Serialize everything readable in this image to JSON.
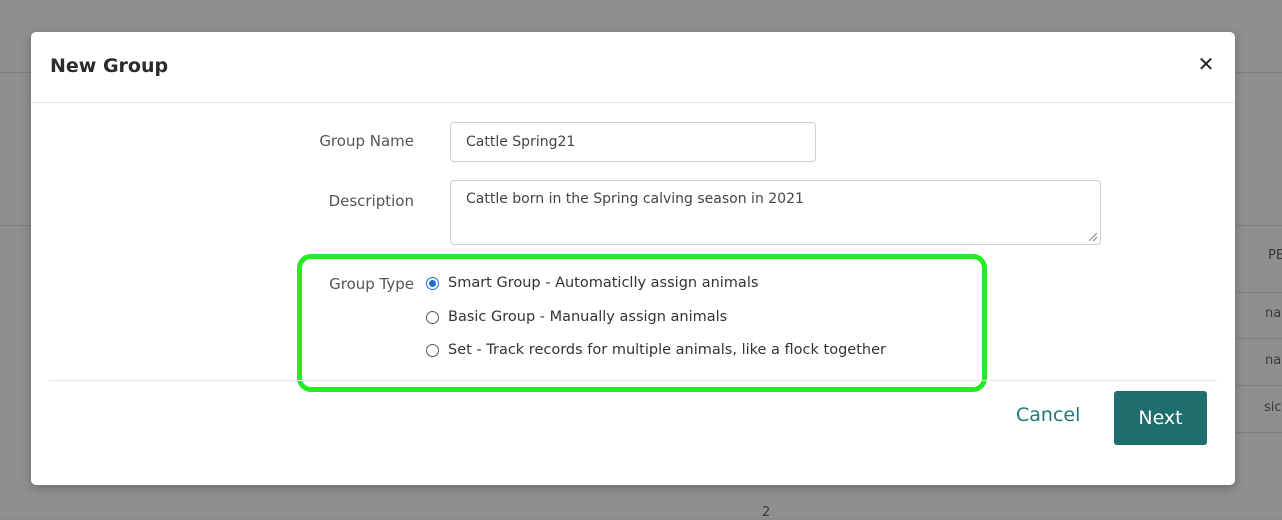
{
  "modal": {
    "title": "New Group",
    "close_icon": "close-icon"
  },
  "form": {
    "group_name": {
      "label": "Group Name",
      "value": "Cattle Spring21"
    },
    "description": {
      "label": "Description",
      "value": "Cattle born in the Spring calving season in 2021"
    },
    "group_type": {
      "label": "Group Type",
      "options": [
        {
          "label": "Smart Group - Automaticlly assign animals",
          "checked": true
        },
        {
          "label": "Basic Group - Manually assign animals",
          "checked": false
        },
        {
          "label": "Set - Track records for multiple animals, like a flock together",
          "checked": false
        }
      ]
    }
  },
  "footer": {
    "cancel_label": "Cancel",
    "next_label": "Next"
  },
  "background": {
    "peek_texts": [
      "PE",
      "na",
      "na",
      "sic",
      "2"
    ]
  },
  "colors": {
    "highlight": "#22ee22",
    "primary": "#1f6e6e",
    "radio_selected": "#1a6ed8"
  }
}
